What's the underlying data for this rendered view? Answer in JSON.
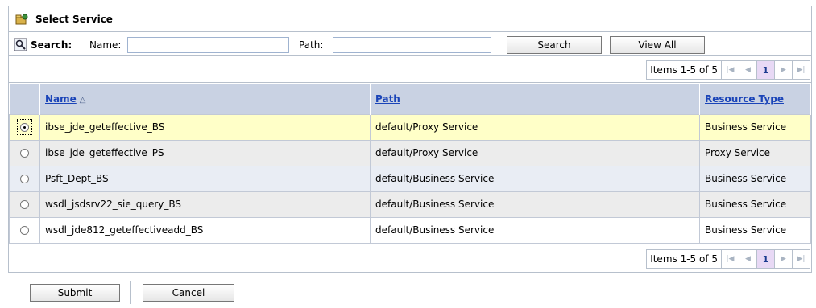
{
  "panel": {
    "title": "Select Service",
    "title_icon": "service-folder-icon"
  },
  "search": {
    "label": "Search:",
    "name_label": "Name:",
    "name_value": "",
    "path_label": "Path:",
    "path_value": "",
    "search_button": "Search",
    "view_all_button": "View All",
    "icon": "search-icon"
  },
  "pager": {
    "items_text": "Items 1-5 of 5",
    "current_page": "1",
    "first_icon": "first-page-icon",
    "prev_icon": "prev-page-icon",
    "next_icon": "next-page-icon",
    "last_icon": "last-page-icon"
  },
  "table": {
    "columns": [
      "Name",
      "Path",
      "Resource Type"
    ],
    "sorted_column": "Name",
    "sort_direction": "ascending",
    "rows": [
      {
        "name": "ibse_jde_geteffective_BS",
        "path": "default/Proxy Service",
        "type": "Business Service",
        "selected": true
      },
      {
        "name": "ibse_jde_geteffective_PS",
        "path": "default/Proxy Service",
        "type": "Proxy Service",
        "selected": false
      },
      {
        "name": "Psft_Dept_BS",
        "path": "default/Business Service",
        "type": "Business Service",
        "selected": false
      },
      {
        "name": "wsdl_jsdsrv22_sie_query_BS",
        "path": "default/Business Service",
        "type": "Business Service",
        "selected": false
      },
      {
        "name": "wsdl_jde812_geteffectiveadd_BS",
        "path": "default/Business Service",
        "type": "Business Service",
        "selected": false
      }
    ]
  },
  "footer": {
    "submit_label": "Submit",
    "cancel_label": "Cancel"
  },
  "colors": {
    "header_bg": "#c9d2e3",
    "selected_row_bg": "#ffffc8",
    "link": "#1a44b8",
    "current_page_bg": "#e8d9f5"
  }
}
